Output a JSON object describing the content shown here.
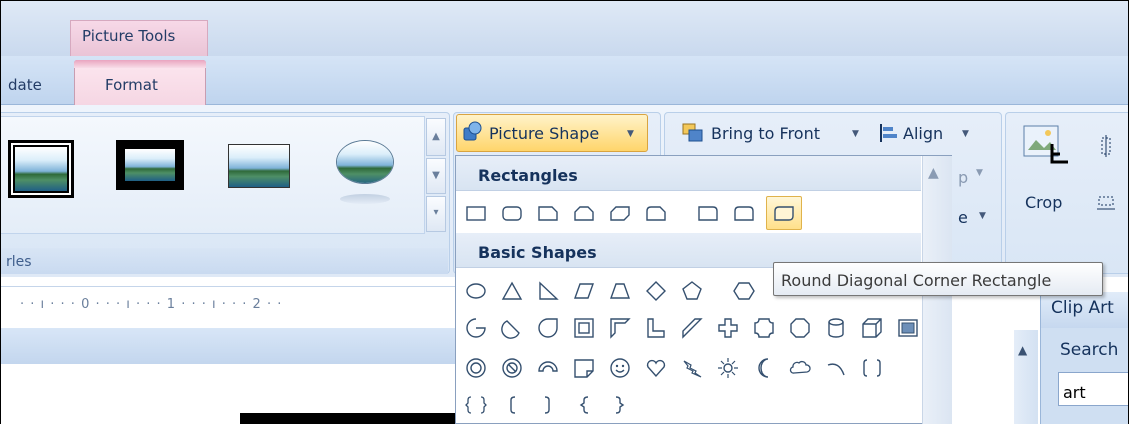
{
  "context_tab": {
    "label": "Picture Tools",
    "color": "#eac4d6"
  },
  "tabs": [
    {
      "label": "date",
      "id": "update"
    },
    {
      "label": "Format",
      "id": "format",
      "active": true
    }
  ],
  "ribbon": {
    "styles_group_label": "rles",
    "picture_shape_label": "Picture Shape",
    "bring_to_front_label": "Bring to Front",
    "align_label": "Align",
    "partial_group_label": "p",
    "partial_rotate_label": "e",
    "crop_label": "Crop"
  },
  "ruler": {
    "marks": "· · ı · · · 0 · · · ı · · · 1 · · · ı · · · 2 · ·"
  },
  "dropdown": {
    "sections": [
      {
        "title": "Rectangles",
        "shapes": [
          "rectangle",
          "rounded-rectangle",
          "snip-single-corner-rectangle",
          "snip-same-side-corner-rectangle",
          "snip-diagonal-corner-rectangle",
          "snip-round-single-corner-rectangle",
          "round-single-corner-rectangle",
          "round-same-side-corner-rectangle",
          "round-diagonal-corner-rectangle"
        ]
      },
      {
        "title": "Basic Shapes",
        "shapes": []
      }
    ],
    "hovered_shape": "round-diagonal-corner-rectangle",
    "tooltip": "Round Diagonal Corner Rectangle"
  },
  "clip_art": {
    "title": "Clip Art",
    "search_label": "Search",
    "search_value": "art"
  },
  "colors": {
    "accent": "#ffd56b",
    "ribbon": "#dfe9f6",
    "active_tab": "#fce6ef",
    "icon_stroke": "#35506f"
  }
}
